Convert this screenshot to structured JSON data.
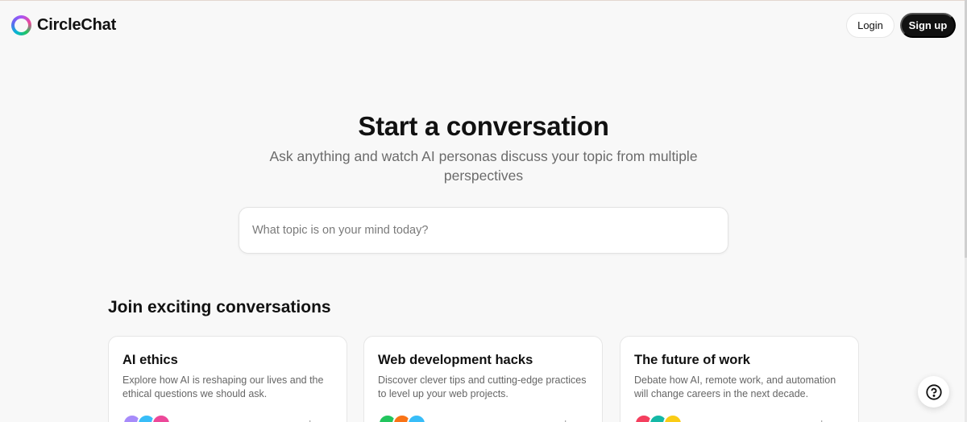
{
  "header": {
    "brand": "CircleChat",
    "login_label": "Login",
    "signup_label": "Sign up"
  },
  "hero": {
    "title": "Start a conversation",
    "subtitle": "Ask anything and watch AI personas discuss your topic from multiple perspectives",
    "search_placeholder": "What topic is on your mind today?"
  },
  "section": {
    "title": "Join exciting conversations"
  },
  "cards": [
    {
      "title": "AI ethics",
      "description": "Explore how AI is reshaping our lives and the ethical questions we should ask.",
      "avatar_colors": [
        "#a78bfa",
        "#38bdf8",
        "#ec4899"
      ]
    },
    {
      "title": "Web development hacks",
      "description": "Discover clever tips and cutting-edge practices to level up your web projects.",
      "avatar_colors": [
        "#22c55e",
        "#f97316",
        "#38bdf8"
      ]
    },
    {
      "title": "The future of work",
      "description": "Debate how AI, remote work, and automation will change careers in the next decade.",
      "avatar_colors": [
        "#f43f5e",
        "#14b8a6",
        "#facc15"
      ]
    }
  ],
  "icons": {
    "logo": "ring-logo-icon",
    "help": "question-circle-icon"
  },
  "colors": {
    "background": "#f8f8f8",
    "primary_button": "#111111",
    "muted_text": "#6b6b6b"
  }
}
